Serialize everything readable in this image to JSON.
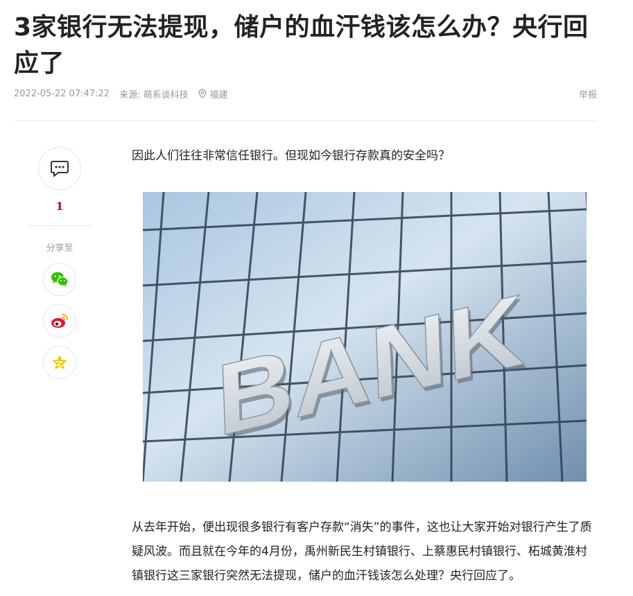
{
  "article": {
    "title": "3家银行无法提现，储户的血汗钱该怎么办？央行回应了",
    "time": "2022-05-22 07:47:22",
    "source": "来源: 萌系谈科技",
    "location": "福建",
    "report_label": "举报",
    "paragraph_1": "因此人们往往非常信任银行。但现如今银行存款真的安全吗？",
    "image_text": "BANK",
    "paragraph_2": "从去年开始，便出现很多银行有客户存款“消失”的事件，这也让大家开始对银行产生了质疑风波。而且就在今年的4月份，禹州新民生村镇银行、上蔡惠民村镇银行、柘城黄淮村镇银行这三家银行突然无法提现，储户的血汗钱该怎么处理？央行回应了。"
  },
  "sidebar": {
    "comment_count": "1",
    "share_label": "分享至",
    "icons": {
      "comment": "comment-icon",
      "wechat": "wechat-icon",
      "weibo": "weibo-icon",
      "qzone": "qzone-icon",
      "location": "location-pin-icon"
    }
  },
  "colors": {
    "accent_red": "#c7000b",
    "meta_gray": "#999999",
    "wechat_green": "#2dc100",
    "weibo_red": "#e6162d",
    "qzone_yellow": "#f6c400"
  }
}
